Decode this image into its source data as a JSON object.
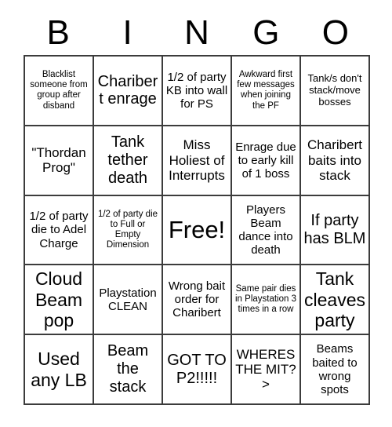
{
  "card": {
    "title": "BINGO",
    "header_letters": [
      "B",
      "I",
      "N",
      "G",
      "O"
    ],
    "grid_size": "5x5",
    "free_space": "Free!",
    "colors": {
      "background": "#ffffff",
      "text": "#000000",
      "grid_line": "#3c3c3c"
    },
    "rows": [
      [
        {
          "text": "Blacklist someone from group after disband",
          "size": "xs"
        },
        {
          "text": "Charibert enrage",
          "size": "xl"
        },
        {
          "text": "1/2 of party KB into wall for PS",
          "size": "md"
        },
        {
          "text": "Awkward first few messages when joining the PF",
          "size": "xs"
        },
        {
          "text": "Tank/s don't stack/move bosses",
          "size": "sm"
        }
      ],
      [
        {
          "text": "\"Thordan Prog\"",
          "size": "lg"
        },
        {
          "text": "Tank tether death",
          "size": "xl"
        },
        {
          "text": "Miss Holiest of Interrupts",
          "size": "lg"
        },
        {
          "text": "Enrage due to early kill of 1 boss",
          "size": "md"
        },
        {
          "text": "Charibert baits into stack",
          "size": "lg"
        }
      ],
      [
        {
          "text": "1/2 of party die to Adel Charge",
          "size": "md"
        },
        {
          "text": "1/2 of party die to Full or Empty Dimension",
          "size": "xs"
        },
        {
          "text": "Free!",
          "size": "free"
        },
        {
          "text": "Players Beam dance into death",
          "size": "md"
        },
        {
          "text": "If party has BLM",
          "size": "xl"
        }
      ],
      [
        {
          "text": "Cloud Beam pop",
          "size": "xxl"
        },
        {
          "text": "Playstation CLEAN",
          "size": "md"
        },
        {
          "text": "Wrong bait order for Charibert",
          "size": "md"
        },
        {
          "text": "Same pair dies in Playstation 3 times in a row",
          "size": "xs"
        },
        {
          "text": "Tank cleaves party",
          "size": "xxl"
        }
      ],
      [
        {
          "text": "Used any LB",
          "size": "xxl"
        },
        {
          "text": "Beam the stack",
          "size": "xl"
        },
        {
          "text": "GOT TO P2!!!!!",
          "size": "xl"
        },
        {
          "text": "WHERES THE MIT?>",
          "size": "lg"
        },
        {
          "text": "Beams baited to wrong spots",
          "size": "md"
        }
      ]
    ]
  }
}
